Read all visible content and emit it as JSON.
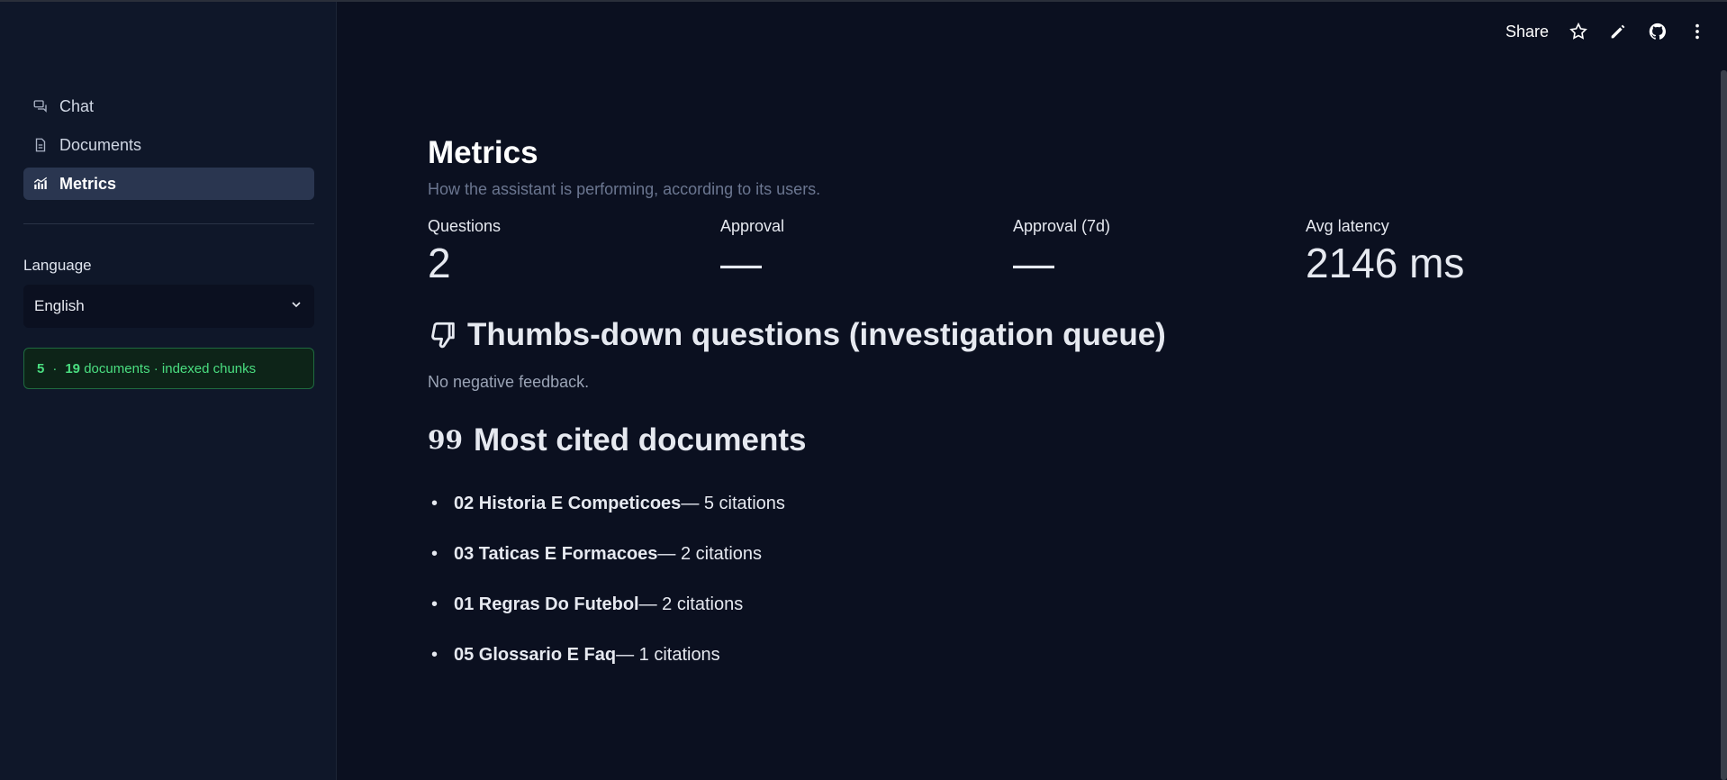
{
  "sidebar": {
    "nav": [
      {
        "label": "Chat",
        "icon": "chat-icon"
      },
      {
        "label": "Documents",
        "icon": "document-icon"
      },
      {
        "label": "Metrics",
        "icon": "chart-icon",
        "active": true
      }
    ],
    "language_label": "Language",
    "language_value": "English",
    "status": {
      "count_a": "5",
      "sep": "·",
      "count_b": "19",
      "text": "documents · indexed chunks"
    }
  },
  "topbar": {
    "share_label": "Share"
  },
  "main": {
    "title": "Metrics",
    "subtitle": "How the assistant is performing, according to its users.",
    "stats": [
      {
        "label": "Questions",
        "value": "2"
      },
      {
        "label": "Approval",
        "value": "—"
      },
      {
        "label": "Approval (7d)",
        "value": "—"
      },
      {
        "label": "Avg latency",
        "value": "2146 ms"
      }
    ],
    "thumbs_title": "Thumbs-down questions (investigation queue)",
    "thumbs_empty": "No negative feedback.",
    "cited_title": "Most cited documents",
    "cited_glyph": "99",
    "bullet": "•",
    "cited_docs": [
      {
        "name": "02 Historia E Competicoes",
        "suffix": " — 5 citations"
      },
      {
        "name": "03 Taticas E Formacoes",
        "suffix": " — 2 citations"
      },
      {
        "name": "01 Regras Do Futebol",
        "suffix": " — 2 citations"
      },
      {
        "name": "05 Glossario E Faq",
        "suffix": " — 1 citations"
      }
    ]
  },
  "colors": {
    "background": "#0b1020",
    "sidebar": "#0f1729",
    "active_nav": "#2a3650",
    "status_green": "#4ade80"
  }
}
